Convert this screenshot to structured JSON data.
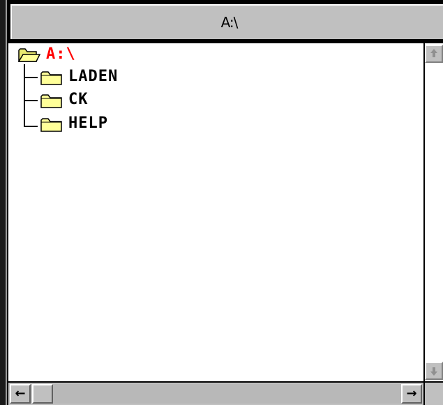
{
  "window": {
    "title": "A:\\"
  },
  "tree": {
    "root": {
      "label": "A:\\",
      "icon": "open-folder-icon",
      "color": "#ff0000"
    },
    "items": [
      {
        "label": "LADEN",
        "icon": "folder-icon"
      },
      {
        "label": "CK",
        "icon": "folder-icon"
      },
      {
        "label": "HELP",
        "icon": "folder-icon"
      }
    ]
  },
  "scrollbars": {
    "vertical": {
      "up_icon": "arrow-up-icon",
      "down_icon": "arrow-down-icon"
    },
    "horizontal": {
      "left_icon": "arrow-left-icon",
      "right_icon": "arrow-right-icon",
      "left_glyph": "←",
      "right_glyph": "→",
      "position": 0
    }
  },
  "colors": {
    "folder_fill": "#ffff99",
    "folder_stroke": "#000000",
    "chrome": "#c0c0c0"
  }
}
